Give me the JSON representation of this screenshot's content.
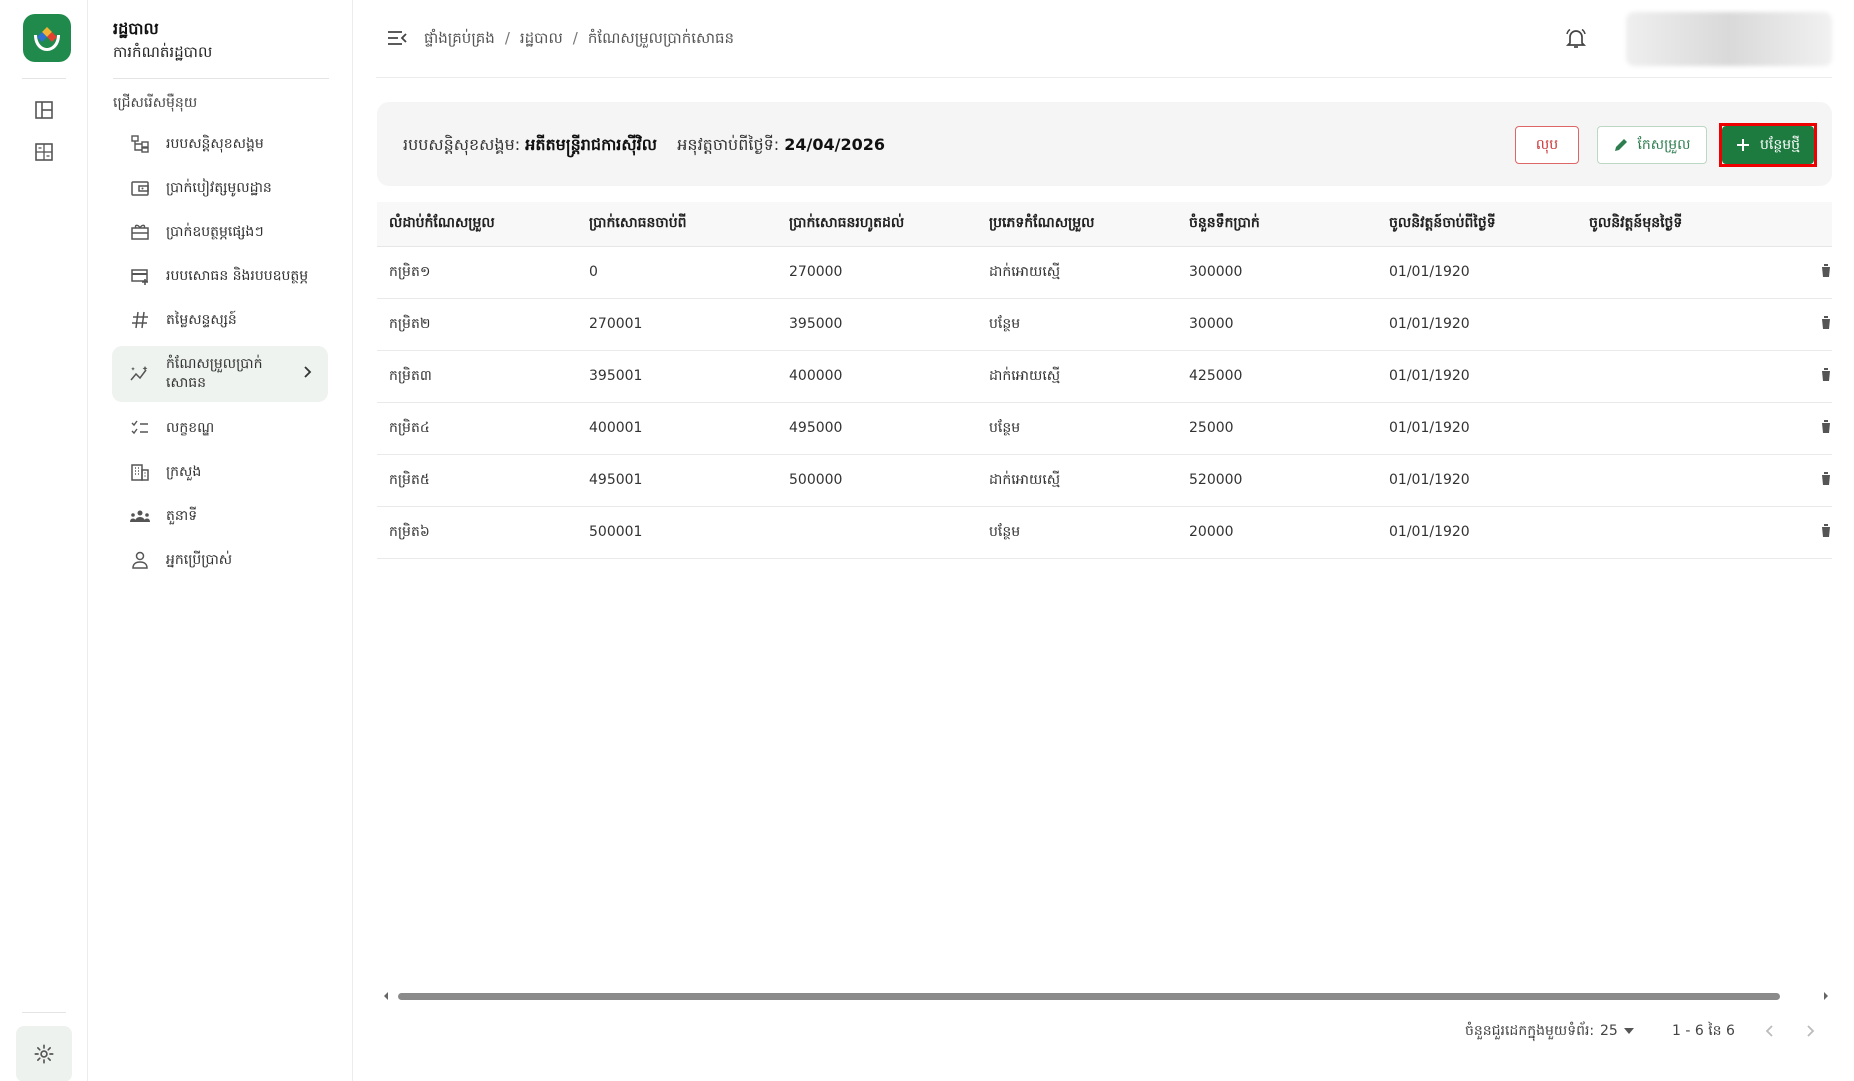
{
  "app": {
    "title": "រដ្ឋបាល",
    "subtitle": "ការកំណត់រដ្ឋបាល",
    "section_label": "ជ្រើសរើសម៉ឺនុយ",
    "accent": "#1e7b3f"
  },
  "sidebar": {
    "items": [
      {
        "label": "របបសន្តិសុខសង្គម",
        "icon": "hierarchy-icon"
      },
      {
        "label": "ប្រាក់បៀវត្សមូលដ្ឋាន",
        "icon": "wallet-icon"
      },
      {
        "label": "ប្រាក់ឧបត្ថម្ភផ្សេងៗ",
        "icon": "gift-icon"
      },
      {
        "label": "របបសោធន និងរបបឧបត្ថម្ភ",
        "icon": "card-plus-icon"
      },
      {
        "label": "តម្លៃសន្ទស្សន៍",
        "icon": "hash-icon"
      },
      {
        "label": "កំណែសម្រួលប្រាក់សោធន",
        "icon": "sparkline-icon",
        "active": true
      },
      {
        "label": "លក្ខខណ្ឌ",
        "icon": "checklist-icon"
      },
      {
        "label": "ក្រសួង",
        "icon": "building-icon"
      },
      {
        "label": "តួនាទី",
        "icon": "group-icon"
      },
      {
        "label": "អ្នកប្រើប្រាស់",
        "icon": "person-icon"
      }
    ]
  },
  "breadcrumb": [
    "ផ្ទាំងគ្រប់គ្រង",
    "រដ្ឋបាល",
    "កំណែសម្រួលប្រាក់សោធន"
  ],
  "info": {
    "scheme_label": "របបសន្តិសុខសង្គម:",
    "scheme_value": "អតីតមន្ត្រីរាជការស៊ីវិល",
    "effective_label": "អនុវត្តចាប់ពីថ្ងៃទី:",
    "effective_value": "24/04/2026"
  },
  "actions": {
    "delete_label": "លុប",
    "edit_label": "កែសម្រួល",
    "new_label": "បន្ថែមថ្មី"
  },
  "table": {
    "columns": [
      "លំដាប់កំណែសម្រួល",
      "ប្រាក់សោធនចាប់ពី",
      "ប្រាក់សោធនរហូតដល់",
      "ប្រភេទកំណែសម្រួល",
      "ចំនួនទឹកប្រាក់",
      "ចូលនិវត្តន៍ចាប់ពីថ្ងៃទី",
      "ចូលនិវត្តន៍មុនថ្ងៃទី"
    ],
    "rows": [
      [
        "កម្រិត១",
        "0",
        "270000",
        "ដាក់អោយស្មើ",
        "300000",
        "01/01/1920",
        ""
      ],
      [
        "កម្រិត២",
        "270001",
        "395000",
        "បន្ថែម",
        "30000",
        "01/01/1920",
        ""
      ],
      [
        "កម្រិត៣",
        "395001",
        "400000",
        "ដាក់អោយស្មើ",
        "425000",
        "01/01/1920",
        ""
      ],
      [
        "កម្រិត៤",
        "400001",
        "495000",
        "បន្ថែម",
        "25000",
        "01/01/1920",
        ""
      ],
      [
        "កម្រិត៥",
        "495001",
        "500000",
        "ដាក់អោយស្មើ",
        "520000",
        "01/01/1920",
        ""
      ],
      [
        "កម្រិត៦",
        "500001",
        "",
        "បន្ថែម",
        "20000",
        "01/01/1920",
        ""
      ]
    ]
  },
  "pagination": {
    "rows_per_page_label": "ចំនួនជួរដេកក្នុងមួយទំព័រ:",
    "rows_per_page": "25",
    "range": "1 - 6 នៃ 6"
  }
}
